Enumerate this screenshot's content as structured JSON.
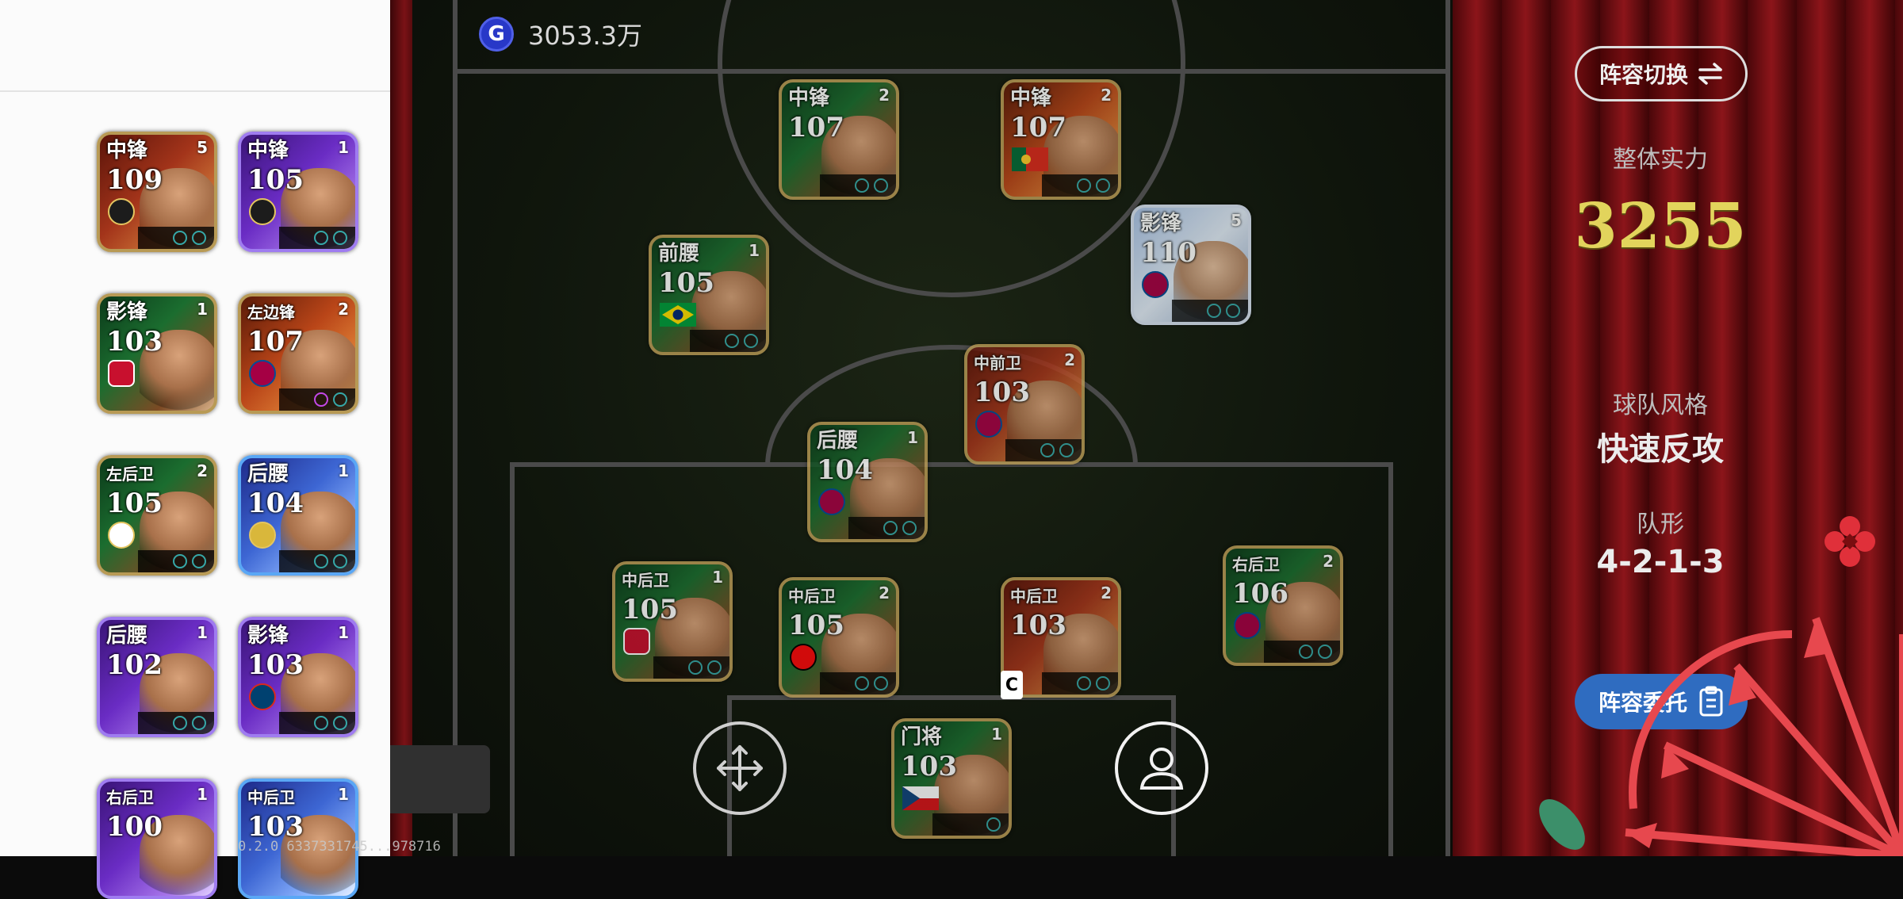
{
  "coin_balance": "3053.3万",
  "coin_icon_letter": "G",
  "build_info": "0.2.0 6337331745...978716",
  "buttons": {
    "lineup_switch": "阵容切换",
    "lineup_entrust": "阵容委托"
  },
  "team_info": {
    "overall_strength_label": "整体实力",
    "overall_strength_value": "3255",
    "team_style_label": "球队风格",
    "team_style_value": "快速反攻",
    "formation_label": "队形",
    "formation_value": "4-2-1-3"
  },
  "captain_marker": "C",
  "reserves": [
    {
      "position": "中锋",
      "rating": "109",
      "level": "5",
      "style": "red"
    },
    {
      "position": "中锋",
      "rating": "105",
      "level": "1",
      "style": "purple"
    },
    {
      "position": "影锋",
      "rating": "103",
      "level": "1",
      "style": "dark"
    },
    {
      "position": "左边锋",
      "rating": "107",
      "level": "2",
      "style": "orange"
    },
    {
      "position": "左后卫",
      "rating": "105",
      "level": "2",
      "style": "dark"
    },
    {
      "position": "后腰",
      "rating": "104",
      "level": "1",
      "style": "blue"
    },
    {
      "position": "后腰",
      "rating": "102",
      "level": "1",
      "style": "purple"
    },
    {
      "position": "影锋",
      "rating": "103",
      "level": "1",
      "style": "purple"
    },
    {
      "position": "右后卫",
      "rating": "100",
      "level": "1",
      "style": "purple"
    },
    {
      "position": "中后卫",
      "rating": "103",
      "level": "1",
      "style": "blue"
    }
  ],
  "starters": [
    {
      "position": "中锋",
      "rating": "107",
      "level": "2",
      "style": "dark"
    },
    {
      "position": "中锋",
      "rating": "107",
      "level": "2",
      "style": "orange"
    },
    {
      "position": "影锋",
      "rating": "110",
      "level": "5",
      "style": "silver"
    },
    {
      "position": "前腰",
      "rating": "105",
      "level": "1",
      "style": "dark"
    },
    {
      "position": "中前卫",
      "rating": "103",
      "level": "2",
      "style": "red"
    },
    {
      "position": "后腰",
      "rating": "104",
      "level": "1",
      "style": "dark"
    },
    {
      "position": "中后卫",
      "rating": "105",
      "level": "1",
      "style": "dark"
    },
    {
      "position": "中后卫",
      "rating": "105",
      "level": "2",
      "style": "dark"
    },
    {
      "position": "中后卫",
      "rating": "103",
      "level": "2",
      "style": "red"
    },
    {
      "position": "右后卫",
      "rating": "106",
      "level": "2",
      "style": "dark"
    },
    {
      "position": "门将",
      "rating": "103",
      "level": "1",
      "style": "dark"
    }
  ]
}
